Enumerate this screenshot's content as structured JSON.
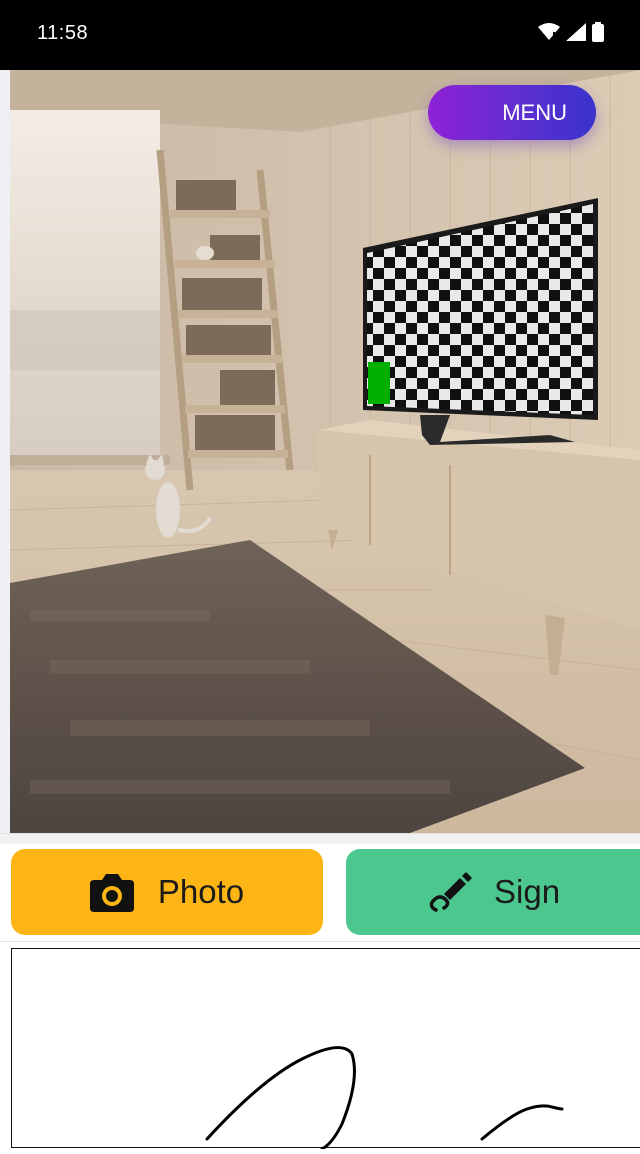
{
  "status_bar": {
    "time": "11:58",
    "icons": [
      "wifi-icon",
      "signal-icon",
      "battery-icon"
    ]
  },
  "menu": {
    "label": "MENU"
  },
  "actions": {
    "photo_label": "Photo",
    "photo_icon": "camera-icon",
    "sign_label": "Sign",
    "sign_icon": "signature-pen-icon"
  },
  "colors": {
    "menu_gradient_start": "#8e22d6",
    "menu_gradient_end": "#3a32cc",
    "photo_button": "#fdb515",
    "sign_button": "#4cc88f",
    "status_bar": "#000000",
    "tv_marker": "#00b000"
  },
  "scene": {
    "description_icon": "room-photo"
  }
}
